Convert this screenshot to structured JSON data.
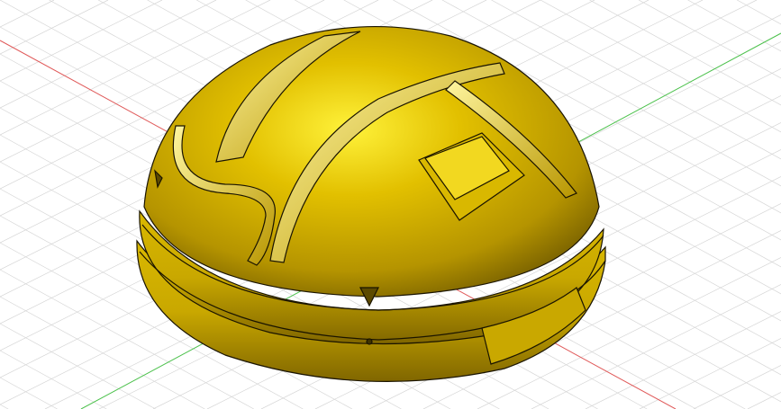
{
  "viewport": {
    "background_color": "#ffffff",
    "grid_color": "#d6d6d6",
    "x_axis_color": "#e05a5a",
    "y_axis_color": "#4cc14c"
  },
  "model": {
    "body_color_light": "#ffe83a",
    "body_color_mid": "#d6b400",
    "body_color_dark": "#7d6500",
    "edge_color": "#1a1400"
  }
}
